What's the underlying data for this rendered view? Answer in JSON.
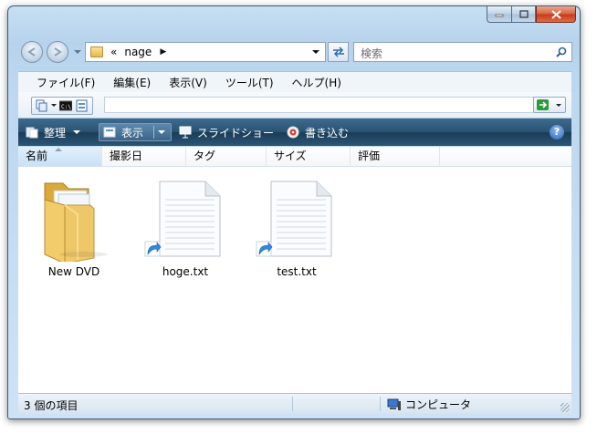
{
  "window": {
    "caption_buttons": [
      "minimize",
      "maximize",
      "close"
    ]
  },
  "address": {
    "overflow_glyph": "«",
    "path": "nage",
    "separator": "▶"
  },
  "search": {
    "placeholder": "検索"
  },
  "menu": [
    "ファイル(F)",
    "編集(E)",
    "表示(V)",
    "ツール(T)",
    "ヘルプ(H)"
  ],
  "toolbar": {
    "organize": "整理",
    "view": "表示",
    "slideshow": "スライドショー",
    "burn": "書き込む",
    "help": "?"
  },
  "columns": [
    "名前",
    "撮影日",
    "タグ",
    "サイズ",
    "評価"
  ],
  "items": [
    {
      "name": "New DVD",
      "icon": "folder-icon"
    },
    {
      "name": "hoge.txt",
      "icon": "text-file-shortcut-icon"
    },
    {
      "name": "test.txt",
      "icon": "text-file-shortcut-icon"
    }
  ],
  "status": {
    "count": "3 個の項目",
    "location": "コンピュータ"
  },
  "colors": {
    "toolbar": "#2a5373",
    "frame": "#bcd7ef",
    "accent": "#2b66b7"
  }
}
